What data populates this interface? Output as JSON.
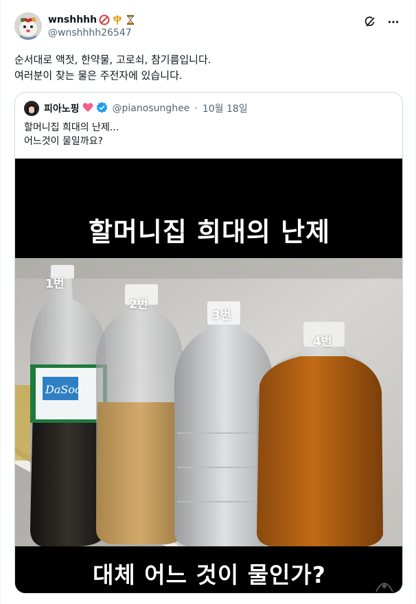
{
  "tweet": {
    "author": {
      "display_name": "wnshhhh",
      "handle": "@wnshhhh26547",
      "badges": [
        "no-entry-icon",
        "trident-icon",
        "hourglass-icon"
      ]
    },
    "text_lines": [
      "순서대로 액젓, 한약물, 고로쇠, 참기름입니다.",
      "여러분이 찾는 물은 주전자에 있습니다."
    ],
    "actions": [
      "grok-icon",
      "more-icon"
    ]
  },
  "quote": {
    "author": {
      "display_name": "피아노핑",
      "handle": "@pianosunghee",
      "verified": true
    },
    "separator": "·",
    "date": "10월 18일",
    "text_lines": [
      "할머니집 희대의 난제...",
      "어느것이 물일까요?"
    ],
    "image": {
      "caption_top": "할머니집 희대의 난제",
      "caption_bottom": "대체 어느 것이 물인가?",
      "bottle_labels": [
        "1번",
        "2번",
        "3번",
        "4번"
      ],
      "bottle_label_text": "DaSoo"
    }
  },
  "colors": {
    "text": "#0f1419",
    "secondary": "#536471",
    "border": "#cfd9de",
    "verified": "#1d9bf0",
    "heart": "#f4608a"
  }
}
